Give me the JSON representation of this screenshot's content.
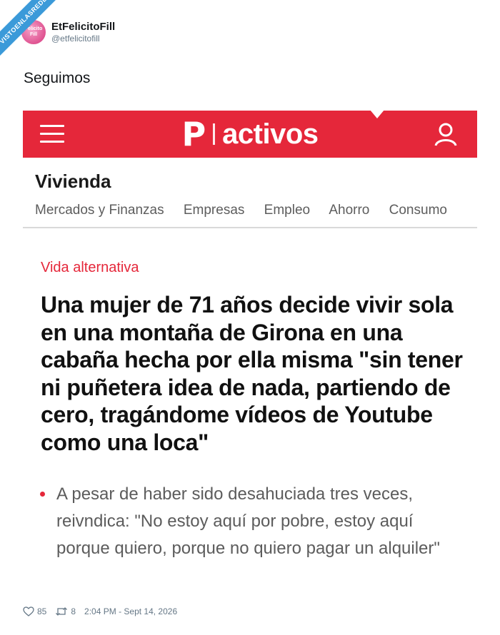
{
  "watermark": "VISTOENLASREDES",
  "tweet": {
    "display_name": "EtFelicitoFill",
    "handle": "@etfelicitofill",
    "avatar_text": "Felicito Fill",
    "text": "Seguimos",
    "likes": "85",
    "retweets": "8",
    "timestamp": "2:04 PM - Sept 14, 2026"
  },
  "article": {
    "logo_letter": "P",
    "logo_word": "activos",
    "section": "Vivienda",
    "nav": [
      "Mercados y Finanzas",
      "Empresas",
      "Empleo",
      "Ahorro",
      "Consumo"
    ],
    "kicker": "Vida alternativa",
    "headline": "Una mujer de 71 años decide vivir sola en una montaña de Girona en una cabaña hecha por ella misma \"sin tener ni puñetera idea de nada, partiendo de cero, tragándome vídeos de Youtube como una loca\"",
    "summary": "A pesar de haber sido desahuciada tres veces, reivndica: \"No estoy aquí por pobre, estoy aquí porque quiero, porque no quiero pagar un alquiler\""
  },
  "colors": {
    "brand_red": "#e5273a",
    "text_dark": "#111111",
    "text_gray": "#5c5c5c",
    "twitter_gray": "#657786"
  },
  "icons": [
    "menu-icon",
    "user-icon",
    "heart-icon",
    "retweet-icon"
  ]
}
